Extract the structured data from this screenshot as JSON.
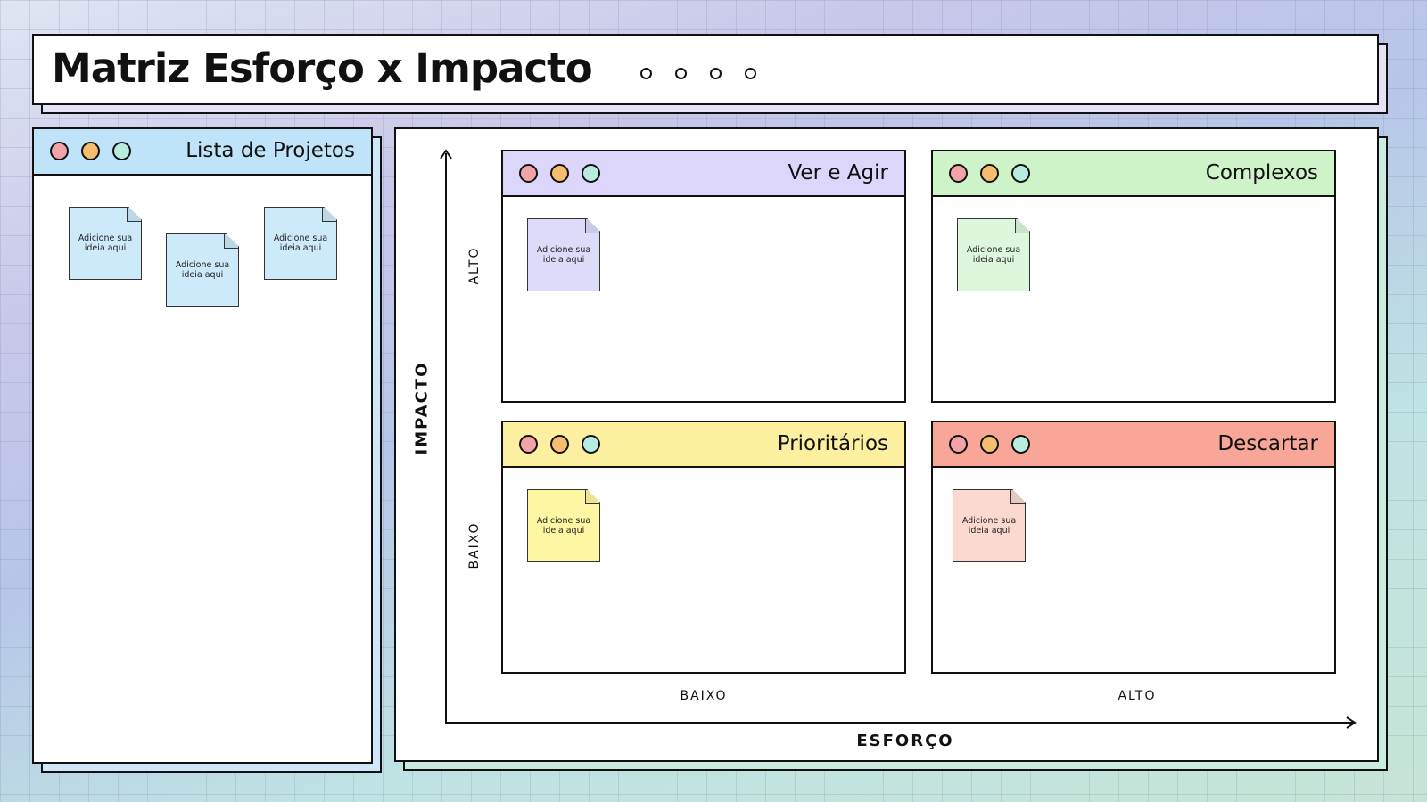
{
  "title": "Matriz Esforço x Impacto",
  "colors": {
    "projects_bar": "#bfe3f8",
    "ver_agir": "#dcd6fb",
    "complexos": "#cff3c8",
    "prioritarios": "#fcf0a0",
    "descartar": "#f7a697",
    "dot_red": "#f2a3a8",
    "dot_orange": "#f5bd6e",
    "dot_teal": "#b7ecdf"
  },
  "projects": {
    "title": "Lista de Projetos",
    "notes": [
      "Adicione sua ideia aqui",
      "Adicione sua ideia aqui",
      "Adicione sua ideia aqui"
    ]
  },
  "matrix": {
    "y_axis": {
      "title": "IMPACTO",
      "high": "ALTO",
      "low": "BAIXO"
    },
    "x_axis": {
      "title": "ESFORÇO",
      "low": "BAIXO",
      "high": "ALTO"
    },
    "quadrants": {
      "ver_agir": {
        "title": "Ver e Agir",
        "note": "Adicione sua ideia aqui"
      },
      "complexos": {
        "title": "Complexos",
        "note": "Adicione sua ideia aqui"
      },
      "prioritarios": {
        "title": "Prioritários",
        "note": "Adicione sua ideia aqui"
      },
      "descartar": {
        "title": "Descartar",
        "note": "Adicione sua ideia aqui"
      }
    }
  }
}
